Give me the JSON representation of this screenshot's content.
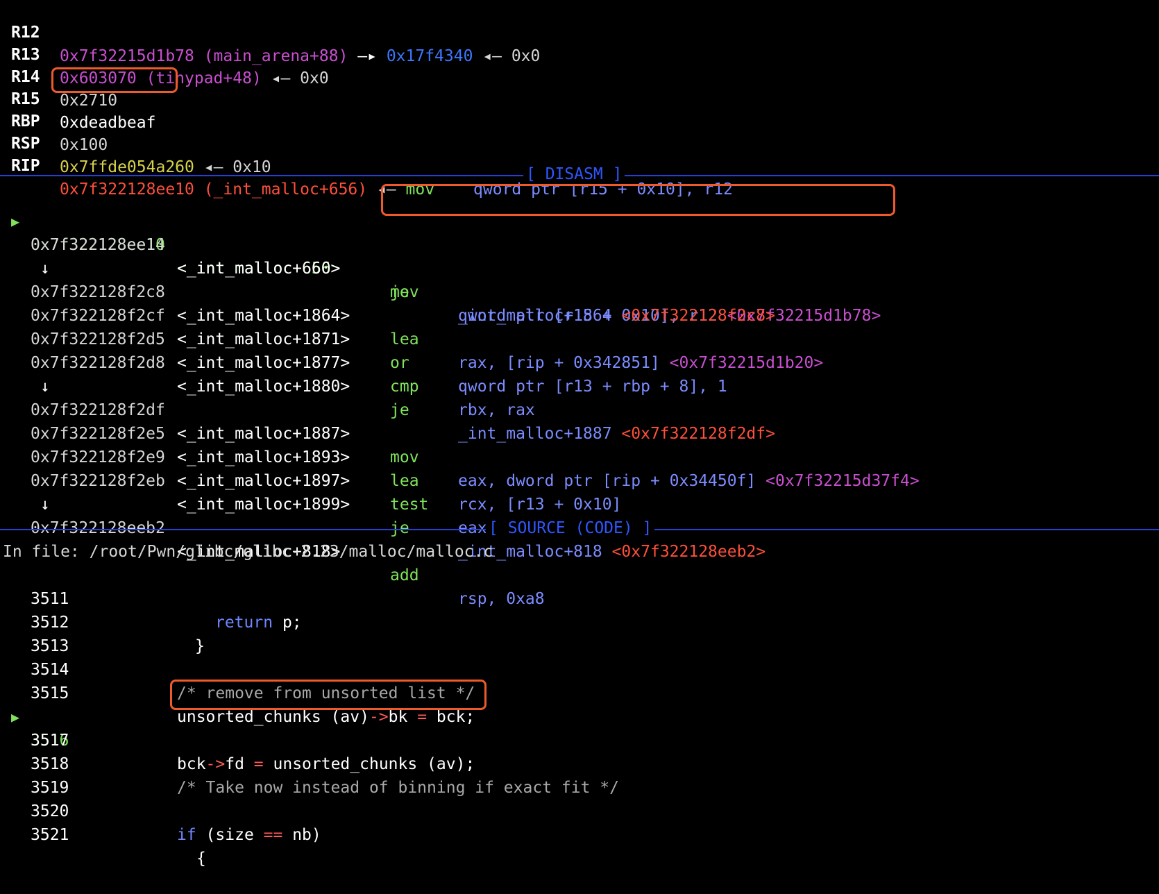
{
  "registers": [
    {
      "name": "R12",
      "value": "0x7f32215d1b78 (main_arena+88)",
      "arrow": " —▸ ",
      "ptr": "0x17f4340",
      "tail": " ◂— 0x0"
    },
    {
      "name": "R13",
      "value": "0x603070 (tinypad+48)",
      "tail": " ◂— 0x0"
    },
    {
      "name": "R14",
      "value": "0x2710"
    },
    {
      "name": "R15",
      "value": "0xdeadbeaf"
    },
    {
      "name": "RBP",
      "value": "0x100"
    },
    {
      "name": "RSP",
      "value": "0x7ffde054a260",
      "tail": " ◂— 0x10"
    },
    {
      "name": "RIP",
      "value": "0x7f322128ee10 (_int_malloc+656)",
      "tail": " ◂— ",
      "insn": "mov",
      "operands": "qword ptr [r15 + 0x10], r12"
    }
  ],
  "disasm_title": "[ DISASM ]",
  "disasm": [
    {
      "current": true,
      "addr": "0x7f322128ee10",
      "sym": "<_int_malloc+656>",
      "mnemonic": "mov",
      "operands": "qword ptr [r15 + 0x10], r12",
      "target": "<0x7f32215d1b78>"
    },
    {
      "addr": "0x7f322128ee14",
      "sym": "<_int_malloc+660>",
      "mnemonic": "je",
      "operands": "_int_malloc+1864",
      "target": "<0x7f322128f2c8>"
    },
    {
      "arrow": "↓"
    },
    {
      "addr": "0x7f322128f2c8",
      "sym": "<_int_malloc+1864>",
      "mnemonic": "lea",
      "operands": "rax, [rip + 0x342851]",
      "target": "<0x7f32215d1b20>"
    },
    {
      "addr": "0x7f322128f2cf",
      "sym": "<_int_malloc+1871>",
      "mnemonic": "or",
      "operands": "qword ptr [r13 + rbp + 8], 1"
    },
    {
      "addr": "0x7f322128f2d5",
      "sym": "<_int_malloc+1877>",
      "mnemonic": "cmp",
      "operands": "rbx, rax"
    },
    {
      "addr": "0x7f322128f2d8",
      "sym": "<_int_malloc+1880>",
      "mnemonic": "je",
      "operands": "_int_malloc+1887",
      "target": "<0x7f322128f2df>"
    },
    {
      "arrow": "↓"
    },
    {
      "addr": "0x7f322128f2df",
      "sym": "<_int_malloc+1887>",
      "mnemonic": "mov",
      "operands": "eax, dword ptr [rip + 0x34450f]",
      "target": "<0x7f32215d37f4>"
    },
    {
      "addr": "0x7f322128f2e5",
      "sym": "<_int_malloc+1893>",
      "mnemonic": "lea",
      "operands": "rcx, [r13 + 0x10]"
    },
    {
      "addr": "0x7f322128f2e9",
      "sym": "<_int_malloc+1897>",
      "mnemonic": "test",
      "operands": "eax, eax"
    },
    {
      "addr": "0x7f322128f2eb",
      "sym": "<_int_malloc+1899>",
      "mnemonic": "je",
      "operands": "_int_malloc+818",
      "target": "<0x7f322128eeb2>"
    },
    {
      "arrow": "↓"
    },
    {
      "addr": "0x7f322128eeb2",
      "sym": "<_int_malloc+818>",
      "mnemonic": "add",
      "operands": "rsp, 0xa8"
    }
  ],
  "source_title": "[ SOURCE (CODE) ]",
  "source_file": "In file: /root/Pwn/glibc/glibc-2.23/malloc/malloc.c",
  "source": [
    {
      "line": "3511",
      "indent": "          ",
      "text": "return p;",
      "kind": "return"
    },
    {
      "line": "3512",
      "indent": "        ",
      "text": "}"
    },
    {
      "line": "3513",
      "indent": "",
      "text": ""
    },
    {
      "line": "3514",
      "indent": "",
      "text": "/* remove from unsorted list */",
      "kind": "comment"
    },
    {
      "line": "3515",
      "indent": "",
      "text": "unsorted_chunks (av)->bk = bck;"
    },
    {
      "line": "3516",
      "indent": "",
      "text": "bck->fd = unsorted_chunks (av);",
      "current": true
    },
    {
      "line": "3517",
      "indent": "",
      "text": ""
    },
    {
      "line": "3518",
      "indent": "",
      "text": "/* Take now instead of binning if exact fit */",
      "kind": "comment"
    },
    {
      "line": "3519",
      "indent": "",
      "text": ""
    },
    {
      "line": "3520",
      "indent": "",
      "text": "if (size == nb)",
      "kind": "if"
    },
    {
      "line": "3521",
      "indent": "  ",
      "text": "{"
    }
  ],
  "colors": {
    "highlight_box": "#ef5a2a",
    "divider": "#2440d8",
    "current_marker": "#7fe35a"
  }
}
